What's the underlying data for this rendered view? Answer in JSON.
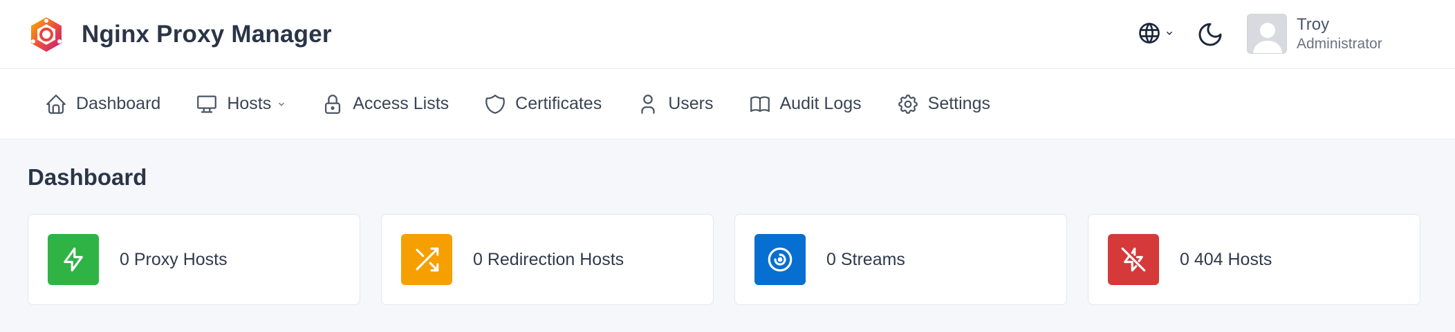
{
  "app": {
    "title": "Nginx Proxy Manager"
  },
  "user": {
    "name": "Troy",
    "role": "Administrator"
  },
  "nav": {
    "items": [
      {
        "label": "Dashboard",
        "icon": "home-icon"
      },
      {
        "label": "Hosts",
        "icon": "monitor-icon",
        "has_dropdown": true
      },
      {
        "label": "Access Lists",
        "icon": "lock-icon"
      },
      {
        "label": "Certificates",
        "icon": "shield-icon"
      },
      {
        "label": "Users",
        "icon": "user-icon"
      },
      {
        "label": "Audit Logs",
        "icon": "book-icon"
      },
      {
        "label": "Settings",
        "icon": "gear-icon"
      }
    ]
  },
  "page": {
    "title": "Dashboard"
  },
  "cards": [
    {
      "text": "0 Proxy Hosts",
      "icon": "bolt-icon",
      "color": "#2fb344"
    },
    {
      "text": "0 Redirection Hosts",
      "icon": "shuffle-icon",
      "color": "#f59f00"
    },
    {
      "text": "0 Streams",
      "icon": "stream-icon",
      "color": "#066fd1"
    },
    {
      "text": "0 404 Hosts",
      "icon": "bolt-off-icon",
      "color": "#d63939"
    }
  ]
}
